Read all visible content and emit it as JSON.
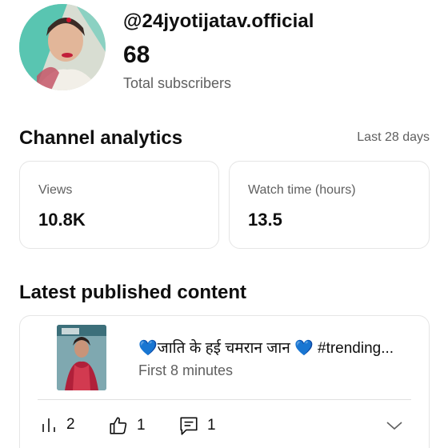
{
  "channel": {
    "handle": "@24jyotijatav.official",
    "subscriber_count": "68",
    "subscriber_label": "Total subscribers"
  },
  "analytics": {
    "title": "Channel analytics",
    "period": "Last 28 days",
    "cards": [
      {
        "label": "Views",
        "value": "10.8K"
      },
      {
        "label": "Watch time (hours)",
        "value": "13.5"
      }
    ]
  },
  "latest": {
    "title": "Latest published content",
    "video": {
      "title": "💙जाति के हई चमरान जान 💙 #trending...",
      "meta": "First 8 minutes",
      "stats": {
        "views": "2",
        "likes": "1",
        "comments": "1"
      }
    }
  },
  "icons": {
    "views": "bar-chart-icon",
    "likes": "thumbs-up-icon",
    "comments": "comment-icon",
    "expand": "chevron-down-icon"
  },
  "colors": {
    "text_primary": "#0f0f0f",
    "text_secondary": "#606060",
    "border": "#e5e5e5"
  }
}
